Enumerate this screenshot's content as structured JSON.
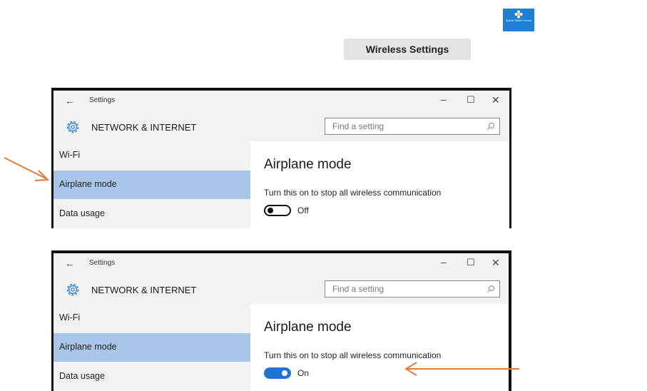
{
  "logo": {
    "text": "Xplore Tablet Corner",
    "color": "#1f7fd2"
  },
  "tag": {
    "label": "Wireless Settings"
  },
  "windows": [
    {
      "title": "Settings",
      "controls": {
        "minimize": "–",
        "maximize": "☐",
        "close": "✕"
      },
      "section": "NETWORK & INTERNET",
      "search_placeholder": "Find a setting",
      "nav": [
        "Wi-Fi",
        "Airplane mode",
        "Data usage"
      ],
      "selected_nav": "Airplane mode",
      "content_title": "Airplane mode",
      "description": "Turn this on to stop all wireless communication",
      "toggle_state": "Off"
    },
    {
      "title": "Settings",
      "controls": {
        "minimize": "–",
        "maximize": "☐",
        "close": "✕"
      },
      "section": "NETWORK & INTERNET",
      "search_placeholder": "Find a setting",
      "nav": [
        "Wi-Fi",
        "Airplane mode",
        "Data usage"
      ],
      "selected_nav": "Airplane mode",
      "content_title": "Airplane mode",
      "description": "Turn this on to stop all wireless communication",
      "toggle_state": "On"
    }
  ],
  "colors": {
    "accent": "#1e76d2",
    "selection": "#a9c6e8",
    "annotation_arrow": "#e07b39"
  }
}
